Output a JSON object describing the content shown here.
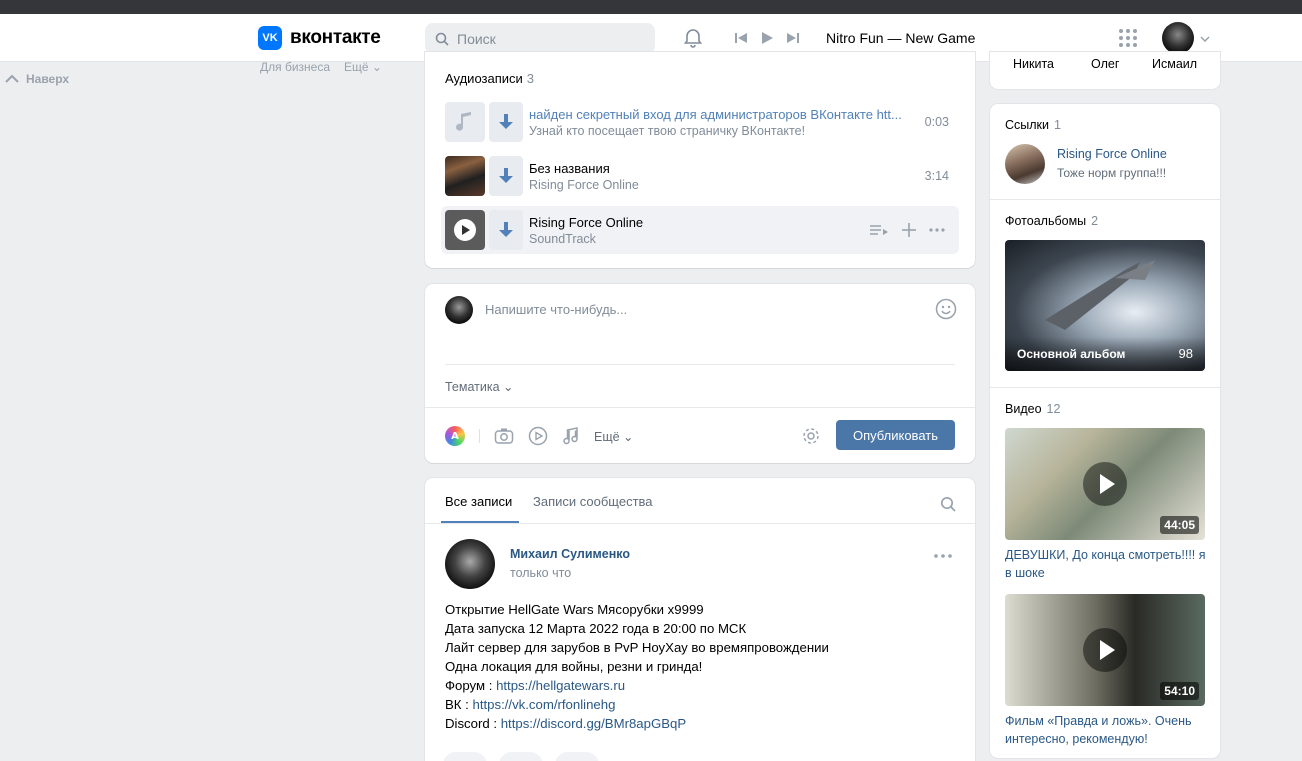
{
  "header": {
    "logo_text": "вконтакте",
    "logo_mark": "VK",
    "search_placeholder": "Поиск",
    "now_playing": "Nitro Fun — New Game"
  },
  "left": {
    "up_label": "Наверх",
    "business": "Для бизнеса",
    "more": "Ещё"
  },
  "audio": {
    "title": "Аудиозаписи",
    "count": "3",
    "tracks": [
      {
        "title": "найден секретный вход для администраторов ВКонтакте htt...",
        "subtitle": "Узнай кто посещает твою страничку ВКонтакте!",
        "duration": "0:03"
      },
      {
        "title": "Без названия",
        "subtitle": "Rising Force Online",
        "duration": "3:14"
      },
      {
        "title": "Rising Force Online",
        "subtitle": "SoundTrack",
        "duration": ""
      }
    ]
  },
  "compose": {
    "placeholder": "Напишите что-нибудь...",
    "topic": "Тематика",
    "more": "Ещё",
    "publish": "Опубликовать"
  },
  "wall": {
    "tab_all": "Все записи",
    "tab_community": "Записи сообщества",
    "post": {
      "author": "Михаил Сулименко",
      "time": "только что",
      "lines": [
        "Открытие HellGate Wars Мясорубки x9999",
        "Дата запуска 12 Марта 2022 года в 20:00 по МСК",
        "Лайт сервер для зарубов в PvP НоуХау во времяпровождении",
        "Одна локация для войны, резни и гринда!"
      ],
      "forum_label": "Форум : ",
      "forum_url": "https://hellgatewars.ru",
      "vk_label": "ВК : ",
      "vk_url": "https://vk.com/rfonlinehg",
      "discord_label": "Discord : ",
      "discord_url": "https://discord.gg/BMr8apGBqP"
    }
  },
  "right": {
    "members": [
      "Никита",
      "Олег",
      "Исмаил"
    ],
    "links_title": "Ссылки",
    "links_count": "1",
    "link_name": "Rising Force Online",
    "link_desc": "Тоже норм группа!!!",
    "albums_title": "Фотоальбомы",
    "albums_count": "2",
    "album_name": "Основной альбом",
    "album_count": "98",
    "videos_title": "Видео",
    "videos_count": "12",
    "videos": [
      {
        "duration": "44:05",
        "title": "ДЕВУШКИ, До конца смотреть!!!! я в шоке"
      },
      {
        "duration": "54:10",
        "title": "Фильм «Правда и ложь». Очень интересно, рекомендую!"
      }
    ]
  }
}
